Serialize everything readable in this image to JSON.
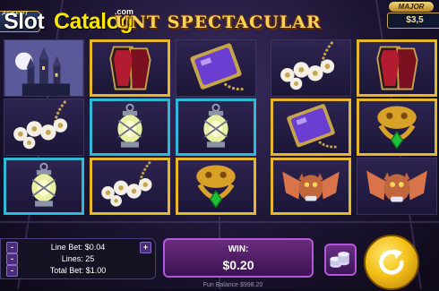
{
  "watermark": {
    "slot": "Slot",
    "catalog": "Catalog",
    "com": ".com"
  },
  "title": "UNT SPECTACULAR",
  "jackpot_left": {
    "label": "ACKPOT"
  },
  "jackpot_right": {
    "label": "MAJOR",
    "amount": "$3,5"
  },
  "reels": [
    [
      "castle-icon",
      "flowers-chain-icon",
      "lantern-icon"
    ],
    [
      "coffin-icon",
      "lantern-icon",
      "flowers-chain-icon"
    ],
    [
      "mirror-icon",
      "lantern-icon",
      "knocker-icon"
    ],
    [
      "flowers-chain-icon",
      "mirror-icon",
      "bat-icon"
    ],
    [
      "coffin-icon",
      "knocker-icon",
      "bat-icon"
    ]
  ],
  "bet_panel": {
    "line_bet": "Line Bet: $0.04",
    "lines": "Lines: 25",
    "total_bet": "Total Bet: $1.00",
    "minus": "-",
    "plus": "+"
  },
  "win": {
    "label": "WIN:",
    "value": "$0.20"
  },
  "balance": "Fun Balance  $998.20",
  "colors": {
    "gold": "#f7d455",
    "highlight_gold": "#e5b72a",
    "highlight_teal": "#2fb8d8",
    "panel_purple": "#6a2a7c"
  }
}
